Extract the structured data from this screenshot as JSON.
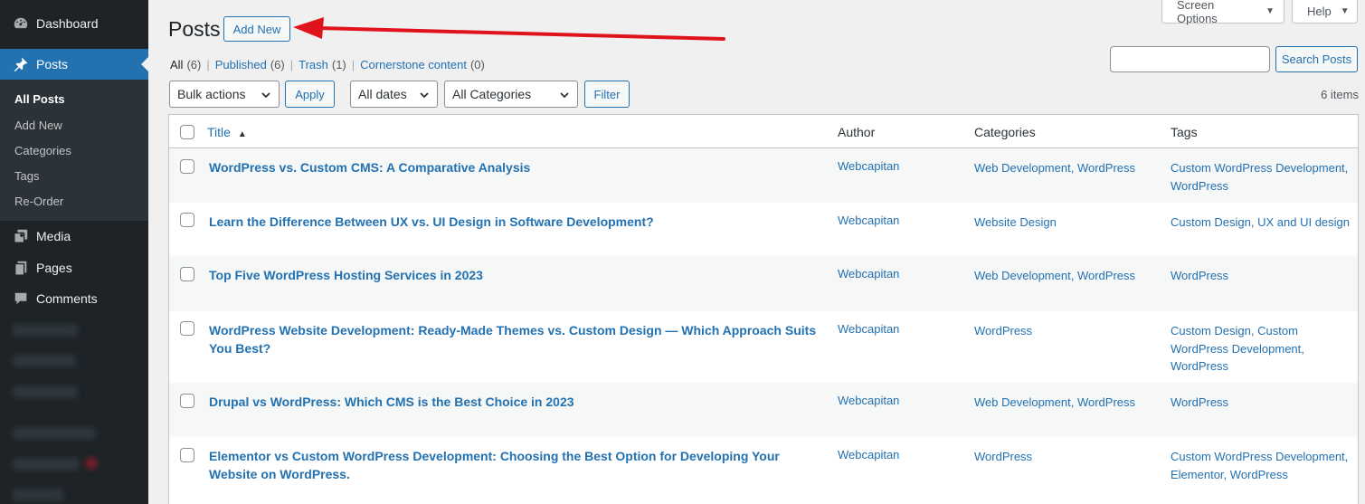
{
  "sidebar": {
    "menu": [
      {
        "label": "Dashboard",
        "icon": "dashboard-icon"
      },
      {
        "label": "Posts",
        "icon": "pin-icon"
      },
      {
        "label": "Media",
        "icon": "media-icon"
      },
      {
        "label": "Pages",
        "icon": "pages-icon"
      },
      {
        "label": "Comments",
        "icon": "comment-icon"
      }
    ],
    "submenu": [
      "All Posts",
      "Add New",
      "Categories",
      "Tags",
      "Re-Order"
    ]
  },
  "screen_options_label": "Screen Options",
  "help_label": "Help",
  "page": {
    "title": "Posts",
    "add_new_label": "Add New"
  },
  "views": [
    {
      "label": "All",
      "count": "(6)"
    },
    {
      "label": "Published",
      "count": "(6)"
    },
    {
      "label": "Trash",
      "count": "(1)"
    },
    {
      "label": "Cornerstone content",
      "count": "(0)"
    }
  ],
  "search": {
    "button_label": "Search Posts",
    "value": ""
  },
  "tablenav": {
    "bulk_actions": "Bulk actions",
    "apply_label": "Apply",
    "dates": "All dates",
    "categories": "All Categories",
    "filter_label": "Filter",
    "items_count": "6 items"
  },
  "table": {
    "columns": [
      "Title",
      "Author",
      "Categories",
      "Tags"
    ],
    "rows": [
      {
        "title": "WordPress vs. Custom CMS: A Comparative Analysis",
        "author": "Webcapitan",
        "categories": [
          "Web Development",
          "WordPress"
        ],
        "tags": [
          "Custom WordPress Development",
          "WordPress"
        ]
      },
      {
        "title": "Learn the Difference Between UX vs. UI Design in Software Development?",
        "author": "Webcapitan",
        "categories": [
          "Website Design"
        ],
        "tags": [
          "Custom Design",
          "UX and UI design"
        ]
      },
      {
        "title": "Top Five WordPress Hosting Services in 2023",
        "author": "Webcapitan",
        "categories": [
          "Web Development",
          "WordPress"
        ],
        "tags": [
          "WordPress"
        ]
      },
      {
        "title": "WordPress Website Development: Ready-Made Themes vs. Custom Design — Which Approach Suits You Best?",
        "author": "Webcapitan",
        "categories": [
          "WordPress"
        ],
        "tags": [
          "Custom Design",
          "Custom WordPress Development",
          "WordPress"
        ]
      },
      {
        "title": "Drupal vs WordPress: Which CMS is the Best Choice in 2023",
        "author": "Webcapitan",
        "categories": [
          "Web Development",
          "WordPress"
        ],
        "tags": [
          "WordPress"
        ]
      },
      {
        "title": "Elementor vs Custom WordPress Development: Choosing the Best Option for Developing Your Website on WordPress.",
        "author": "Webcapitan",
        "categories": [
          "WordPress"
        ],
        "tags": [
          "Custom WordPress Development",
          "Elementor",
          "WordPress"
        ]
      }
    ]
  },
  "colors": {
    "sidebar_bg": "#1d2327",
    "accent": "#2271b1",
    "arrow": "#e0121b"
  }
}
